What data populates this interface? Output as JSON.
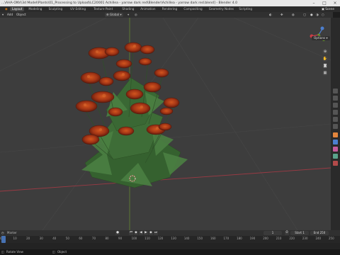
{
  "window": {
    "title": "...\\AHA-ONV\\3d Model\\Plants\\01_Processing to Upload\\LC20001 Achillea - yarrow dark red\\Blender\\Achillea - yarrow dark red.blend] - Blender 4.0"
  },
  "workspaces": [
    {
      "label": "Layout",
      "active": true
    },
    {
      "label": "Modeling"
    },
    {
      "label": "Sculpting"
    },
    {
      "label": "UV Editing"
    },
    {
      "label": "Texture Paint"
    },
    {
      "label": "Shading"
    },
    {
      "label": "Animation"
    },
    {
      "label": "Rendering"
    },
    {
      "label": "Compositing"
    },
    {
      "label": "Geometry Nodes"
    },
    {
      "label": "Scripting"
    }
  ],
  "scene": {
    "label": "Scene"
  },
  "header": {
    "add": "Add",
    "object": "Object",
    "orientation": "Global"
  },
  "viewport": {
    "options": "Options"
  },
  "timeline": {
    "marker": "Marker",
    "current_frame": "1",
    "start_label": "Start",
    "start": "1",
    "end_label": "End",
    "end": "250",
    "ticks": [
      "0",
      "10",
      "20",
      "30",
      "40",
      "50",
      "60",
      "70",
      "80",
      "90",
      "100",
      "110",
      "120",
      "130",
      "140",
      "150",
      "160",
      "170",
      "180",
      "190",
      "200",
      "210",
      "220",
      "230",
      "240",
      "250"
    ]
  },
  "statusbar": {
    "select": "Rotate View",
    "object": "Object"
  },
  "colors": {
    "accent": "#4772b3",
    "flower_dark": "#7a2210",
    "flower_light": "#c8491e",
    "leaf": "#3d6b3a",
    "x_axis": "#c83c46",
    "y_axis": "#6a9a2c"
  }
}
